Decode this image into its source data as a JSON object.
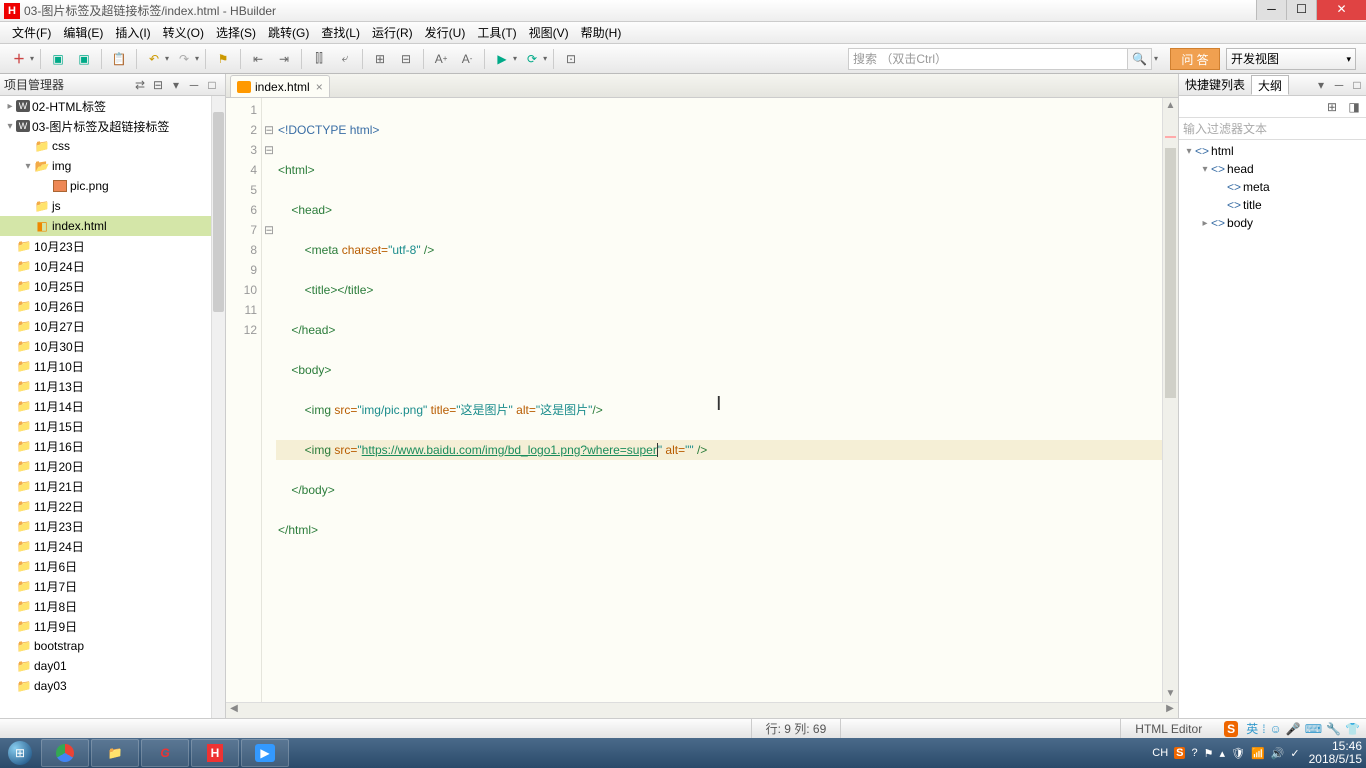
{
  "window": {
    "title": "03-图片标签及超链接标签/index.html  -  HBuilder",
    "app_initial": "H"
  },
  "menu": [
    "文件(F)",
    "编辑(E)",
    "插入(I)",
    "转义(O)",
    "选择(S)",
    "跳转(G)",
    "查找(L)",
    "运行(R)",
    "发行(U)",
    "工具(T)",
    "视图(V)",
    "帮助(H)"
  ],
  "toolbar": {
    "search_placeholder": "搜索 （双击Ctrl）",
    "qa_label": "问 答",
    "view_label": "开发视图"
  },
  "project_panel": {
    "title": "项目管理器",
    "items": [
      {
        "depth": 0,
        "toggle": "▸",
        "icon": "w",
        "label": "02-HTML标签"
      },
      {
        "depth": 0,
        "toggle": "▾",
        "icon": "w",
        "label": "03-图片标签及超链接标签"
      },
      {
        "depth": 1,
        "toggle": "",
        "icon": "folder",
        "label": "css"
      },
      {
        "depth": 1,
        "toggle": "▾",
        "icon": "folder-open",
        "label": "img"
      },
      {
        "depth": 2,
        "toggle": "",
        "icon": "pic",
        "label": "pic.png"
      },
      {
        "depth": 1,
        "toggle": "",
        "icon": "folder",
        "label": "js"
      },
      {
        "depth": 1,
        "toggle": "",
        "icon": "html",
        "label": "index.html",
        "selected": true
      },
      {
        "depth": 0,
        "toggle": "",
        "icon": "folder",
        "label": "10月23日"
      },
      {
        "depth": 0,
        "toggle": "",
        "icon": "folder",
        "label": "10月24日"
      },
      {
        "depth": 0,
        "toggle": "",
        "icon": "folder",
        "label": "10月25日"
      },
      {
        "depth": 0,
        "toggle": "",
        "icon": "folder",
        "label": "10月26日"
      },
      {
        "depth": 0,
        "toggle": "",
        "icon": "folder",
        "label": "10月27日"
      },
      {
        "depth": 0,
        "toggle": "",
        "icon": "folder",
        "label": "10月30日"
      },
      {
        "depth": 0,
        "toggle": "",
        "icon": "folder",
        "label": "11月10日"
      },
      {
        "depth": 0,
        "toggle": "",
        "icon": "folder",
        "label": "11月13日"
      },
      {
        "depth": 0,
        "toggle": "",
        "icon": "folder",
        "label": "11月14日"
      },
      {
        "depth": 0,
        "toggle": "",
        "icon": "folder",
        "label": "11月15日"
      },
      {
        "depth": 0,
        "toggle": "",
        "icon": "folder",
        "label": "11月16日"
      },
      {
        "depth": 0,
        "toggle": "",
        "icon": "folder",
        "label": "11月20日"
      },
      {
        "depth": 0,
        "toggle": "",
        "icon": "folder",
        "label": "11月21日"
      },
      {
        "depth": 0,
        "toggle": "",
        "icon": "folder",
        "label": "11月22日"
      },
      {
        "depth": 0,
        "toggle": "",
        "icon": "folder",
        "label": "11月23日"
      },
      {
        "depth": 0,
        "toggle": "",
        "icon": "folder",
        "label": "11月24日"
      },
      {
        "depth": 0,
        "toggle": "",
        "icon": "folder",
        "label": "11月6日"
      },
      {
        "depth": 0,
        "toggle": "",
        "icon": "folder",
        "label": "11月7日"
      },
      {
        "depth": 0,
        "toggle": "",
        "icon": "folder",
        "label": "11月8日"
      },
      {
        "depth": 0,
        "toggle": "",
        "icon": "folder",
        "label": "11月9日"
      },
      {
        "depth": 0,
        "toggle": "",
        "icon": "folder",
        "label": "bootstrap"
      },
      {
        "depth": 0,
        "toggle": "",
        "icon": "folder",
        "label": "day01"
      },
      {
        "depth": 0,
        "toggle": "",
        "icon": "folder",
        "label": "day03"
      }
    ]
  },
  "editor": {
    "tab_label": "index.html",
    "line_numbers": [
      "1",
      "2",
      "3",
      "4",
      "5",
      "6",
      "7",
      "8",
      "9",
      "10",
      "11",
      "12"
    ],
    "fold_marks": [
      "",
      "⊟",
      "⊟",
      "",
      "",
      "",
      "⊟",
      "",
      "",
      "",
      "",
      ""
    ],
    "code": {
      "l1_a": "<!DOCTYPE ",
      "l1_b": "html",
      "l1_c": ">",
      "l2": "<html>",
      "l3": "<head>",
      "l4_a": "<meta ",
      "l4_b": "charset=",
      "l4_c": "\"utf-8\"",
      "l4_d": " />",
      "l5": "<title></title>",
      "l6": "</head>",
      "l7": "<body>",
      "l8_a": "<img ",
      "l8_b": "src=",
      "l8_c": "\"img/pic.png\"",
      "l8_d": " title=",
      "l8_e": "\"这是图片\"",
      "l8_f": " alt=",
      "l8_g": "\"这是图片\"",
      "l8_h": "/>",
      "l9_a": "<img ",
      "l9_b": "src=",
      "l9_c": "\"",
      "l9_url": "https://www.baidu.com/img/bd_logo1.png?where=super",
      "l9_d": "\"",
      "l9_e": " alt=",
      "l9_f": "\"\"",
      "l9_g": " />",
      "l10": "</body>",
      "l11": "</html>"
    }
  },
  "outline": {
    "tab1": "快捷键列表",
    "tab2": "大纲",
    "filter_placeholder": "输入过滤器文本",
    "items": [
      {
        "depth": 0,
        "toggle": "▾",
        "label": "html"
      },
      {
        "depth": 1,
        "toggle": "▾",
        "label": "head"
      },
      {
        "depth": 2,
        "toggle": "",
        "label": "meta"
      },
      {
        "depth": 2,
        "toggle": "",
        "label": "title"
      },
      {
        "depth": 1,
        "toggle": "▸",
        "label": "body"
      }
    ]
  },
  "status": {
    "position": "行: 9 列: 69",
    "editor_type": "HTML Editor"
  },
  "tray": {
    "ime1": "CH",
    "ime2": "英",
    "time": "15:46",
    "date": "2018/5/15"
  }
}
